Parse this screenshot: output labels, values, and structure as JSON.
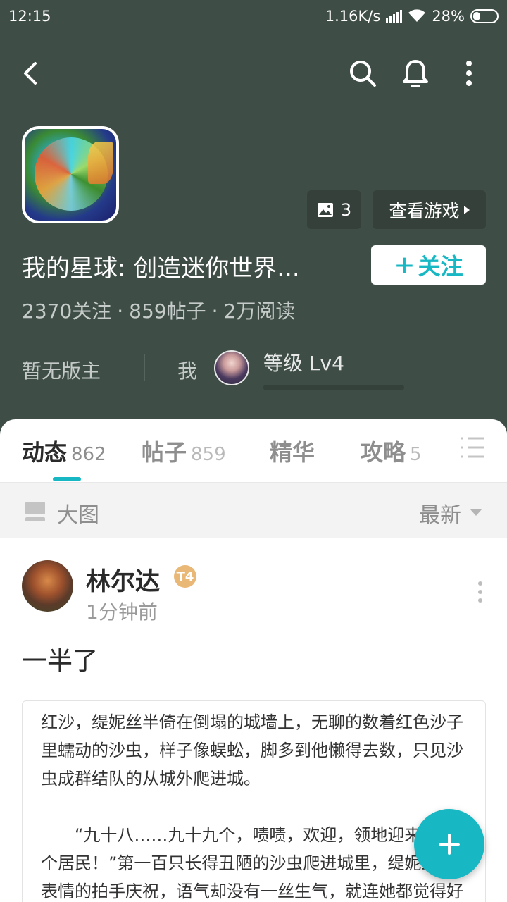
{
  "status_bar": {
    "time": "12:15",
    "network_speed": "1.16K/s",
    "battery": "28%"
  },
  "game": {
    "title": "我的星球: 创造迷你世界...",
    "image_count": "3",
    "view_game_label": "查看游戏",
    "follow_label": "关注",
    "stats": {
      "followers": "2370关注",
      "posts": "859帖子",
      "reads": "2万阅读"
    },
    "moderator": "暂无版主",
    "me_label": "我",
    "level": "等级 Lv4"
  },
  "tabs": [
    {
      "label": "动态",
      "count": "862"
    },
    {
      "label": "帖子",
      "count": "859"
    },
    {
      "label": "精华",
      "count": ""
    },
    {
      "label": "攻略",
      "count": "5"
    }
  ],
  "filter": {
    "view_label": "大图",
    "sort_label": "最新"
  },
  "post": {
    "author": "林尔达",
    "badge": "T4",
    "time": "1分钟前",
    "title": "一半了",
    "excerpt": [
      "红沙，缇妮丝半倚在倒塌的城墙上，无聊的数着红色沙子里蠕动的沙虫，样子像蜈蚣，脚多到他懒得去数，只见沙虫成群结队的从城外爬进城。",
      "“九十八……九十九个，啧啧，欢迎，领地迎来一百个居民！”第一百只长得丑陋的沙虫爬进城里，缇妮丝无表情的拍手庆祝，语气却没有一丝生气，就连她都觉得好可怕耶。"
    ]
  },
  "colors": {
    "header_bg": "#3f4d47",
    "accent": "#17b7c3"
  },
  "icons": [
    "back-icon",
    "search-icon",
    "bell-icon",
    "more-vertical-icon",
    "image-icon",
    "list-icon",
    "big-image-view-icon",
    "plus-icon"
  ]
}
